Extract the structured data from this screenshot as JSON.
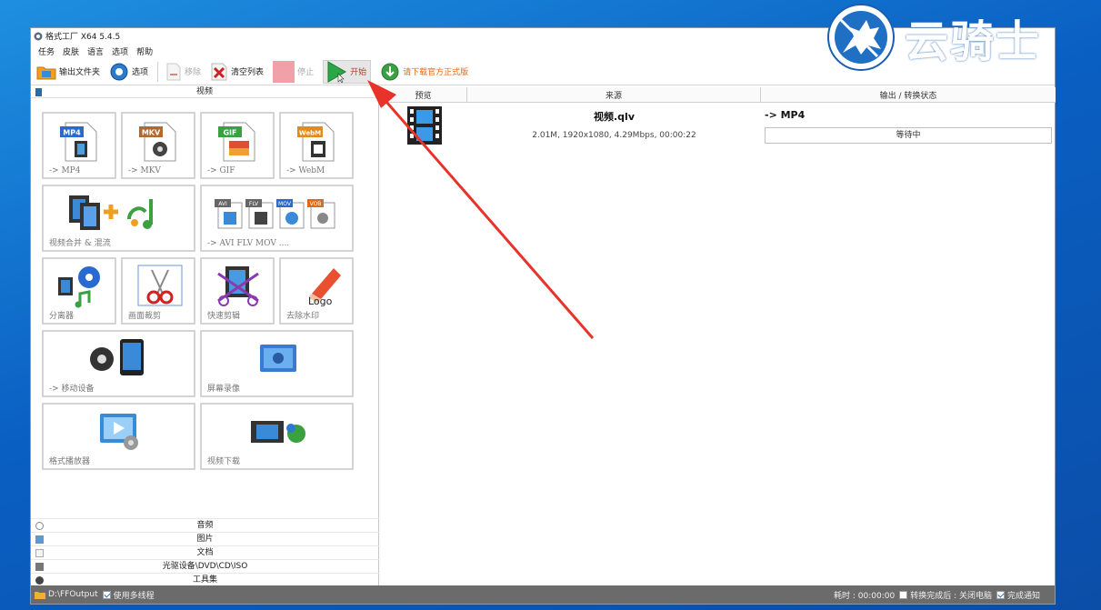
{
  "window": {
    "title": "格式工厂 X64 5.4.5"
  },
  "menu": [
    "任务",
    "皮肤",
    "语言",
    "选项",
    "帮助"
  ],
  "toolbar": {
    "output_folder": "输出文件夹",
    "options": "选项",
    "remove": "移除",
    "clear_list": "清空列表",
    "stop": "停止",
    "start": "开始",
    "download": "请下载官方正式版"
  },
  "left_panel": {
    "header": "视频",
    "tiles": [
      {
        "label": "-> MP4",
        "badge": "MP4"
      },
      {
        "label": "-> MKV",
        "badge": "MKV"
      },
      {
        "label": "-> GIF",
        "badge": "GIF"
      },
      {
        "label": "-> WebM",
        "badge": "WebM"
      },
      {
        "label": "视频合并 & 混流"
      },
      {
        "label": "-> AVI FLV MOV ....",
        "badges": [
          "AVI",
          "FLV",
          "MOV",
          "VOB"
        ]
      },
      {
        "label": "分离器"
      },
      {
        "label": "画面裁剪"
      },
      {
        "label": "快速剪辑"
      },
      {
        "label": "去除水印",
        "logo_text": "Logo"
      },
      {
        "label": "-> 移动设备"
      },
      {
        "label": "屏幕录像"
      },
      {
        "label": "格式播放器"
      },
      {
        "label": "视频下载"
      }
    ],
    "categories": [
      "音频",
      "图片",
      "文档",
      "光驱设备\\DVD\\CD\\ISO",
      "工具集"
    ]
  },
  "task_list": {
    "columns": [
      "预览",
      "来源",
      "输出 / 转换状态"
    ],
    "rows": [
      {
        "file_name": "视频.qlv",
        "file_info": "2.01M, 1920x1080, 4.29Mbps, 00:00:22",
        "output": "-> MP4",
        "status": "等待中"
      }
    ]
  },
  "statusbar": {
    "output_path": "D:\\FFOutput",
    "multithread": "使用多线程",
    "elapsed": "耗时 : 00:00:00",
    "after_convert": "转换完成后 : 关闭电脑",
    "notify": "完成通知"
  },
  "watermark": {
    "text": "云骑士"
  },
  "colors": {
    "accent_arrow": "#e8332b",
    "start_green": "#2aa845",
    "statusbar": "#6b6b6b"
  }
}
